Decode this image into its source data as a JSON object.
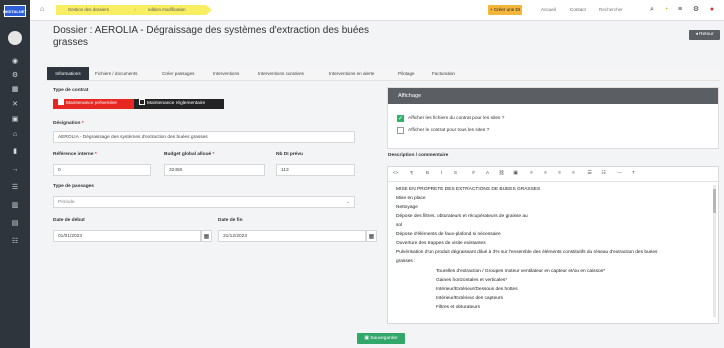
{
  "logo": {
    "text": "DIGITALNET"
  },
  "breadcrumb": [
    {
      "label": "Gestion des dossiers"
    },
    {
      "label": "edition modification"
    }
  ],
  "topbar": {
    "create_label": "+ Créer une DI",
    "accueil": "Accueil",
    "contact": "Contact",
    "search_placeholder": "Rechercher"
  },
  "page": {
    "title": "Dossier : AEROLIA - Dégraissage des systèmes d'extraction des buées grasses",
    "retour": "Retour"
  },
  "tabs": [
    {
      "label": "Informations"
    },
    {
      "label": "Fichiers / documents"
    },
    {
      "label": "Créer passages"
    },
    {
      "label": "Interventions"
    },
    {
      "label": "Interventions curatives"
    },
    {
      "label": "Interventions en alerte"
    },
    {
      "label": "Pilotage"
    },
    {
      "label": "Facturation"
    }
  ],
  "form": {
    "type_contrat_label": "Type de contrat",
    "maintenance_preventive": "Maintenance préventive",
    "maintenance_reglementaire": "Maintenance réglementaire",
    "designation_label": "Désignation",
    "designation_value": "AEROLIA - Dégraissage des systèmes d'extraction des buées grasses",
    "reference_label": "Référence interne",
    "reference_value": "0",
    "budget_label": "Budget global alloué",
    "budget_value": "32450",
    "nbdi_label": "Nb DI prévu",
    "nbdi_value": "113",
    "type_passages_label": "Type de passages",
    "type_passages_value": "Période",
    "date_debut_label": "Date de début",
    "date_debut_value": "01/01/2023",
    "date_fin_label": "Date de fin",
    "date_fin_value": "31/12/2023"
  },
  "affichage": {
    "title": "Affichage",
    "option1": "Afficher les fichiers du contrat pour les sites ?",
    "option2": "Afficher le contrat pour tous les sites ?"
  },
  "description": {
    "label": "Description / commentaire",
    "lines": [
      "MISE EN PROPRETE DES EXTRACTIONS DE BUEES GRASSES",
      "Mise en place",
      "Nettoyage",
      "Dépose des filtres, obturateurs et récupérateurs de graisse au",
      "sol",
      "Dépose d'éléments de faux-plafond si nécessaire",
      "Ouverture des trappes de visite existantes",
      "Pulvérisation d'un produit dégraissant dilué à 3% sur l'ensemble des éléments constitutifs du réseau d'extraction des buées",
      "grasses :",
      "Tourelles d'extraction / Groupes moteur ventilateur en capteur et/ou en caisson*",
      "Gaines horizontales et verticales*",
      "Intérieur/Extérieur/Dessous des hottes",
      "Intérieur/Extérieur des capteurs",
      "Filtres et obturateurs"
    ]
  },
  "save_label": "Sauvegarder"
}
